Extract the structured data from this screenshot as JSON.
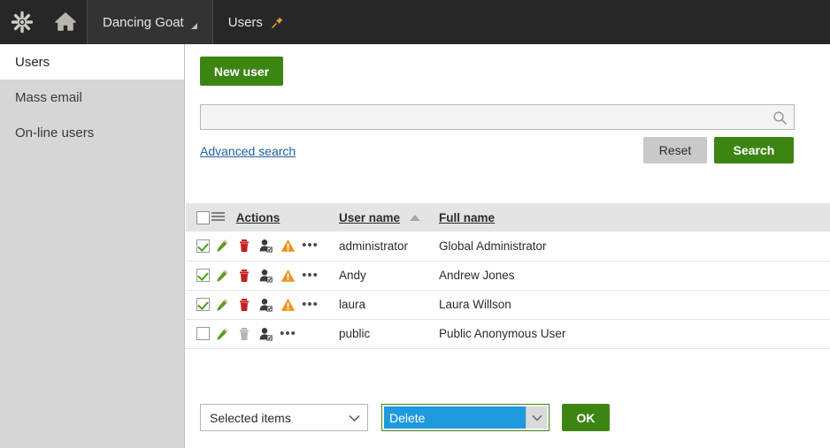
{
  "topbar": {
    "logo_icon": "kentico-asterisk-logo",
    "home_icon": "home-icon",
    "site_tab": "Dancing Goat",
    "app_tab": "Users",
    "pin_icon": "pushpin-icon",
    "bg_color": "#272727"
  },
  "sidebar": {
    "items": [
      {
        "label": "Users",
        "active": true
      },
      {
        "label": "Mass email",
        "active": false
      },
      {
        "label": "On-line users",
        "active": false
      }
    ],
    "bg_color": "#d6d6d6"
  },
  "toolbar": {
    "new_user_label": "New user"
  },
  "search": {
    "value": "",
    "placeholder": "",
    "icon": "search-icon",
    "advanced_label": "Advanced search",
    "reset_label": "Reset",
    "search_label": "Search"
  },
  "grid": {
    "headers": {
      "checkbox": "",
      "menu_icon": "hamburger-menu-icon",
      "actions": "Actions",
      "user_name": "User name",
      "full_name": "Full name"
    },
    "sort": {
      "column": "User name",
      "direction": "ascending"
    },
    "row_action_icons": [
      "edit-pencil-icon",
      "delete-trash-icon",
      "user-roles-icon",
      "warning-triangle-icon",
      "more-actions-icon"
    ],
    "rows": [
      {
        "selected": true,
        "user_name": "administrator",
        "full_name": "Global Administrator",
        "has_warning": true,
        "delete_enabled": true
      },
      {
        "selected": true,
        "user_name": "Andy",
        "full_name": "Andrew Jones",
        "has_warning": true,
        "delete_enabled": true
      },
      {
        "selected": true,
        "user_name": "laura",
        "full_name": "Laura Willson",
        "has_warning": true,
        "delete_enabled": true
      },
      {
        "selected": false,
        "user_name": "public",
        "full_name": "Public Anonymous User",
        "has_warning": false,
        "delete_enabled": false
      }
    ]
  },
  "footer": {
    "scope_select_value": "Selected items",
    "action_select_value": "Delete",
    "ok_label": "OK"
  },
  "colors": {
    "green": "#3c8513",
    "gray_button": "#c9c9c9",
    "link_blue": "#1e5fa8",
    "highlight_blue": "#1e9ade",
    "warning_orange": "#e8941a",
    "delete_red": "#c3201f",
    "edit_green": "#5a9e20"
  }
}
